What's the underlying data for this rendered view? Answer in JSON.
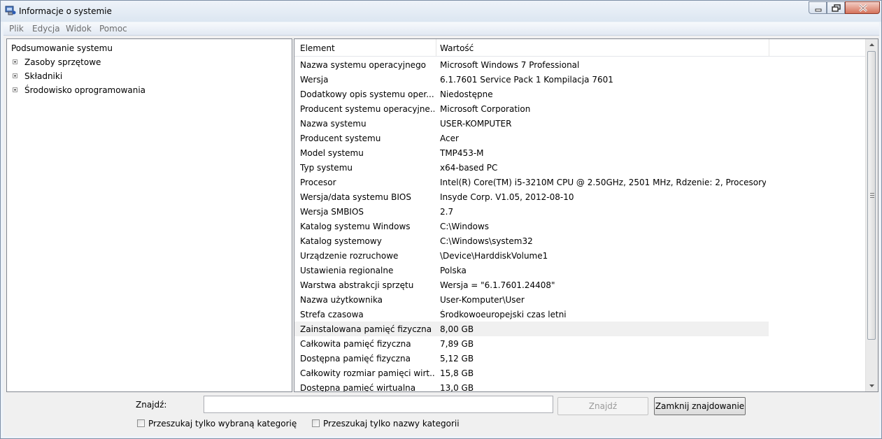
{
  "window": {
    "title": "Informacje o systemie"
  },
  "menu": [
    "Plik",
    "Edycja",
    "Widok",
    "Pomoc"
  ],
  "tree": [
    {
      "label": "Podsumowanie systemu",
      "expandable": false
    },
    {
      "label": "Zasoby sprzętowe",
      "expandable": true
    },
    {
      "label": "Składniki",
      "expandable": true
    },
    {
      "label": "Środowisko oprogramowania",
      "expandable": true
    }
  ],
  "list": {
    "columns": [
      "Element",
      "Wartość"
    ],
    "rows": [
      [
        "Nazwa systemu operacyjnego",
        "Microsoft Windows 7 Professional"
      ],
      [
        "Wersja",
        "6.1.7601 Service Pack 1 Kompilacja 7601"
      ],
      [
        "Dodatkowy opis systemu oper...",
        "Niedostępne"
      ],
      [
        "Producent systemu operacyjne...",
        "Microsoft Corporation"
      ],
      [
        "Nazwa systemu",
        "USER-KOMPUTER"
      ],
      [
        "Producent systemu",
        "Acer"
      ],
      [
        "Model systemu",
        "TMP453-M"
      ],
      [
        "Typ systemu",
        "x64-based PC"
      ],
      [
        "Procesor",
        "Intel(R) Core(TM) i5-3210M CPU @ 2.50GHz, 2501 MHz, Rdzenie: 2, Procesory..."
      ],
      [
        "Wersja/data systemu BIOS",
        "Insyde Corp. V1.05, 2012-08-10"
      ],
      [
        "Wersja SMBIOS",
        "2.7"
      ],
      [
        "Katalog systemu Windows",
        "C:\\Windows"
      ],
      [
        "Katalog systemowy",
        "C:\\Windows\\system32"
      ],
      [
        "Urządzenie rozruchowe",
        "\\Device\\HarddiskVolume1"
      ],
      [
        "Ustawienia regionalne",
        "Polska"
      ],
      [
        "Warstwa abstrakcji sprzętu",
        "Wersja = \"6.1.7601.24408\""
      ],
      [
        "Nazwa użytkownika",
        "User-Komputer\\User"
      ],
      [
        "Strefa czasowa",
        "Środkowoeuropejski czas letni"
      ],
      [
        "Zainstalowana pamięć fizyczna ...",
        "8,00 GB"
      ],
      [
        "Całkowita pamięć fizyczna",
        "7,89 GB"
      ],
      [
        "Dostępna pamięć fizyczna",
        "5,12 GB"
      ],
      [
        "Całkowity rozmiar pamięci wirt...",
        "15,8 GB"
      ],
      [
        "Dostępna pamięć wirtualna",
        "13,0 GB"
      ]
    ],
    "selected_index": 18
  },
  "find": {
    "label": "Znajdź:",
    "value": "",
    "find_button": "Znajdź",
    "close_button": "Zamknij znajdowanie",
    "check1": "Przeszukaj tylko wybraną kategorię",
    "check2": "Przeszukaj tylko nazwy kategorii"
  }
}
